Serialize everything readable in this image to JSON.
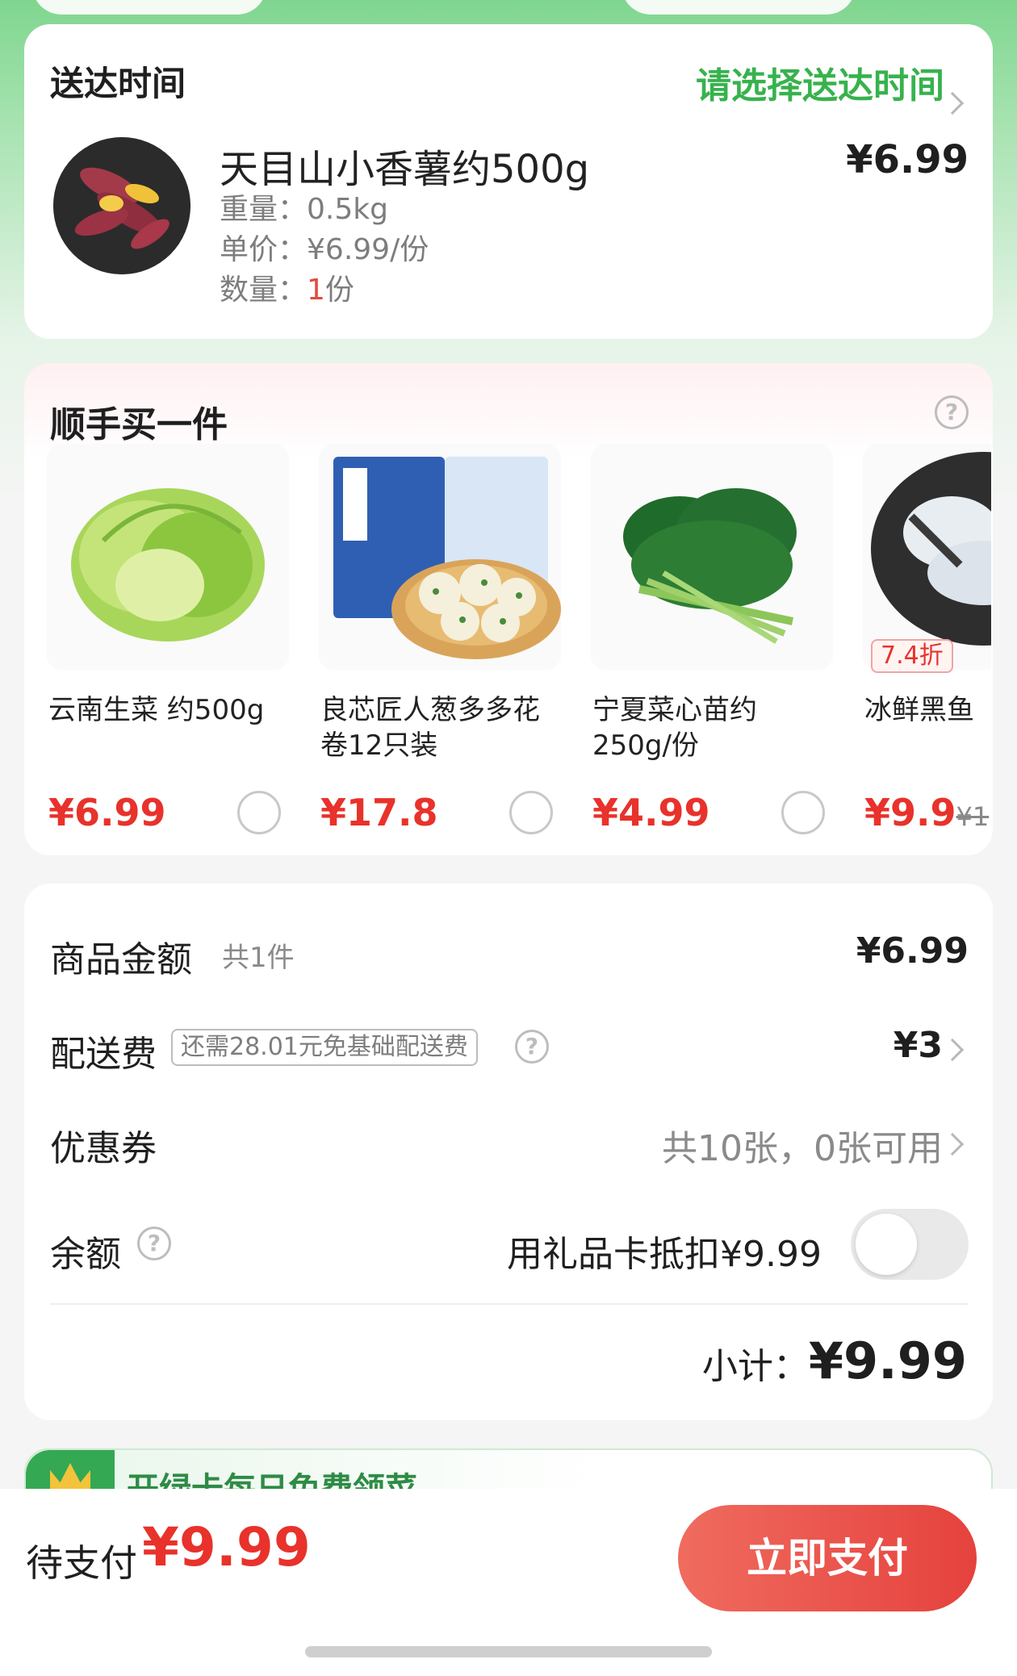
{
  "delivery": {
    "title": "送达时间",
    "select_time": "请选择送达时间"
  },
  "product": {
    "image_icon": "sweet-potato-image",
    "name": "天目山小香薯约500g",
    "price": "¥6.99",
    "weight_label": "重量：",
    "weight": "0.5kg",
    "unit_price_label": "单价：",
    "unit_price": "¥6.99/份",
    "quantity_label": "数量：",
    "quantity_num": "1",
    "quantity_unit": "份"
  },
  "addon": {
    "title": "顺手买一件",
    "items": [
      {
        "image_icon": "lettuce-image",
        "name": "云南生菜 约500g",
        "price": "¥6.99",
        "orig": "",
        "badge": ""
      },
      {
        "image_icon": "scallion-rolls-image",
        "name": "良芯匠人葱多多花卷12只装",
        "price": "¥17.8",
        "orig": "",
        "badge": ""
      },
      {
        "image_icon": "greens-image",
        "name": "宁夏菜心苗约250g/份",
        "price": "¥4.99",
        "orig": "",
        "badge": ""
      },
      {
        "image_icon": "fish-fillet-image",
        "name": "冰鲜黑鱼",
        "price": "¥9.9",
        "orig": "¥1",
        "badge": "7.4折"
      }
    ]
  },
  "summary": {
    "goods_label": "商品金额",
    "goods_count": "共1件",
    "goods_amount": "¥6.99",
    "delivery_label": "配送费",
    "delivery_tag": "还需28.01元免基础配送费",
    "delivery_fee": "¥3",
    "coupon_label": "优惠券",
    "coupon_value": "共10张，0张可用",
    "balance_label": "余额",
    "gift_card_text": "用礼品卡抵扣¥9.99",
    "gift_card_toggle_on": false,
    "subtotal_label": "小计：",
    "subtotal_amount": "¥9.99"
  },
  "banner": {
    "text": "开绿卡每日免费领菜"
  },
  "footer": {
    "due_label": "待支付",
    "due_amount": "¥9.99",
    "pay_button": "立即支付"
  },
  "colors": {
    "brand_green": "#37b24d",
    "price_red": "#e8322b",
    "pay_button": "#e5423d"
  }
}
